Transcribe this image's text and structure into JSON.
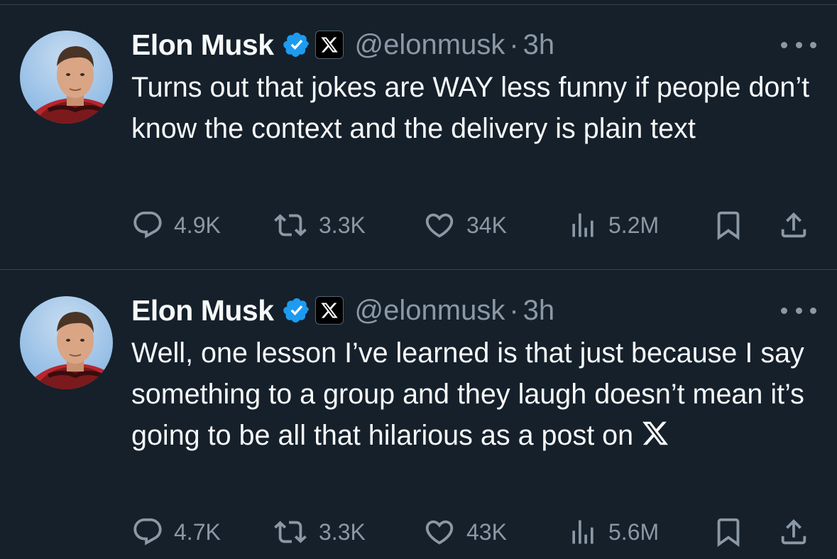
{
  "tweets": [
    {
      "author_name": "Elon Musk",
      "handle": "@elonmusk",
      "separator": "·",
      "time": "3h",
      "text": "Turns out that jokes are WAY less funny if people don’t know the context and the delivery is plain text",
      "text_suffix_x_icon": false,
      "replies": "4.9K",
      "reposts": "3.3K",
      "likes": "34K",
      "views": "5.2M"
    },
    {
      "author_name": "Elon Musk",
      "handle": "@elonmusk",
      "separator": "·",
      "time": "3h",
      "text": "Well, one lesson I’ve learned is that just because I say something to a group and they laugh doesn’t mean it’s going to be all that hilarious as a post on",
      "text_suffix_x_icon": true,
      "replies": "4.7K",
      "reposts": "3.3K",
      "likes": "43K",
      "views": "5.6M"
    }
  ],
  "icons": {
    "verified": "verified-badge-icon",
    "affiliation": "x-logo-icon",
    "more": "more-icon",
    "reply": "reply-icon",
    "repost": "repost-icon",
    "like": "like-icon",
    "views": "views-icon",
    "bookmark": "bookmark-icon",
    "share": "share-icon"
  },
  "colors": {
    "background": "#15202b",
    "text": "#f7f9f9",
    "muted": "#8b98a5",
    "verified": "#1d9bf0",
    "divider": "#38444d"
  }
}
